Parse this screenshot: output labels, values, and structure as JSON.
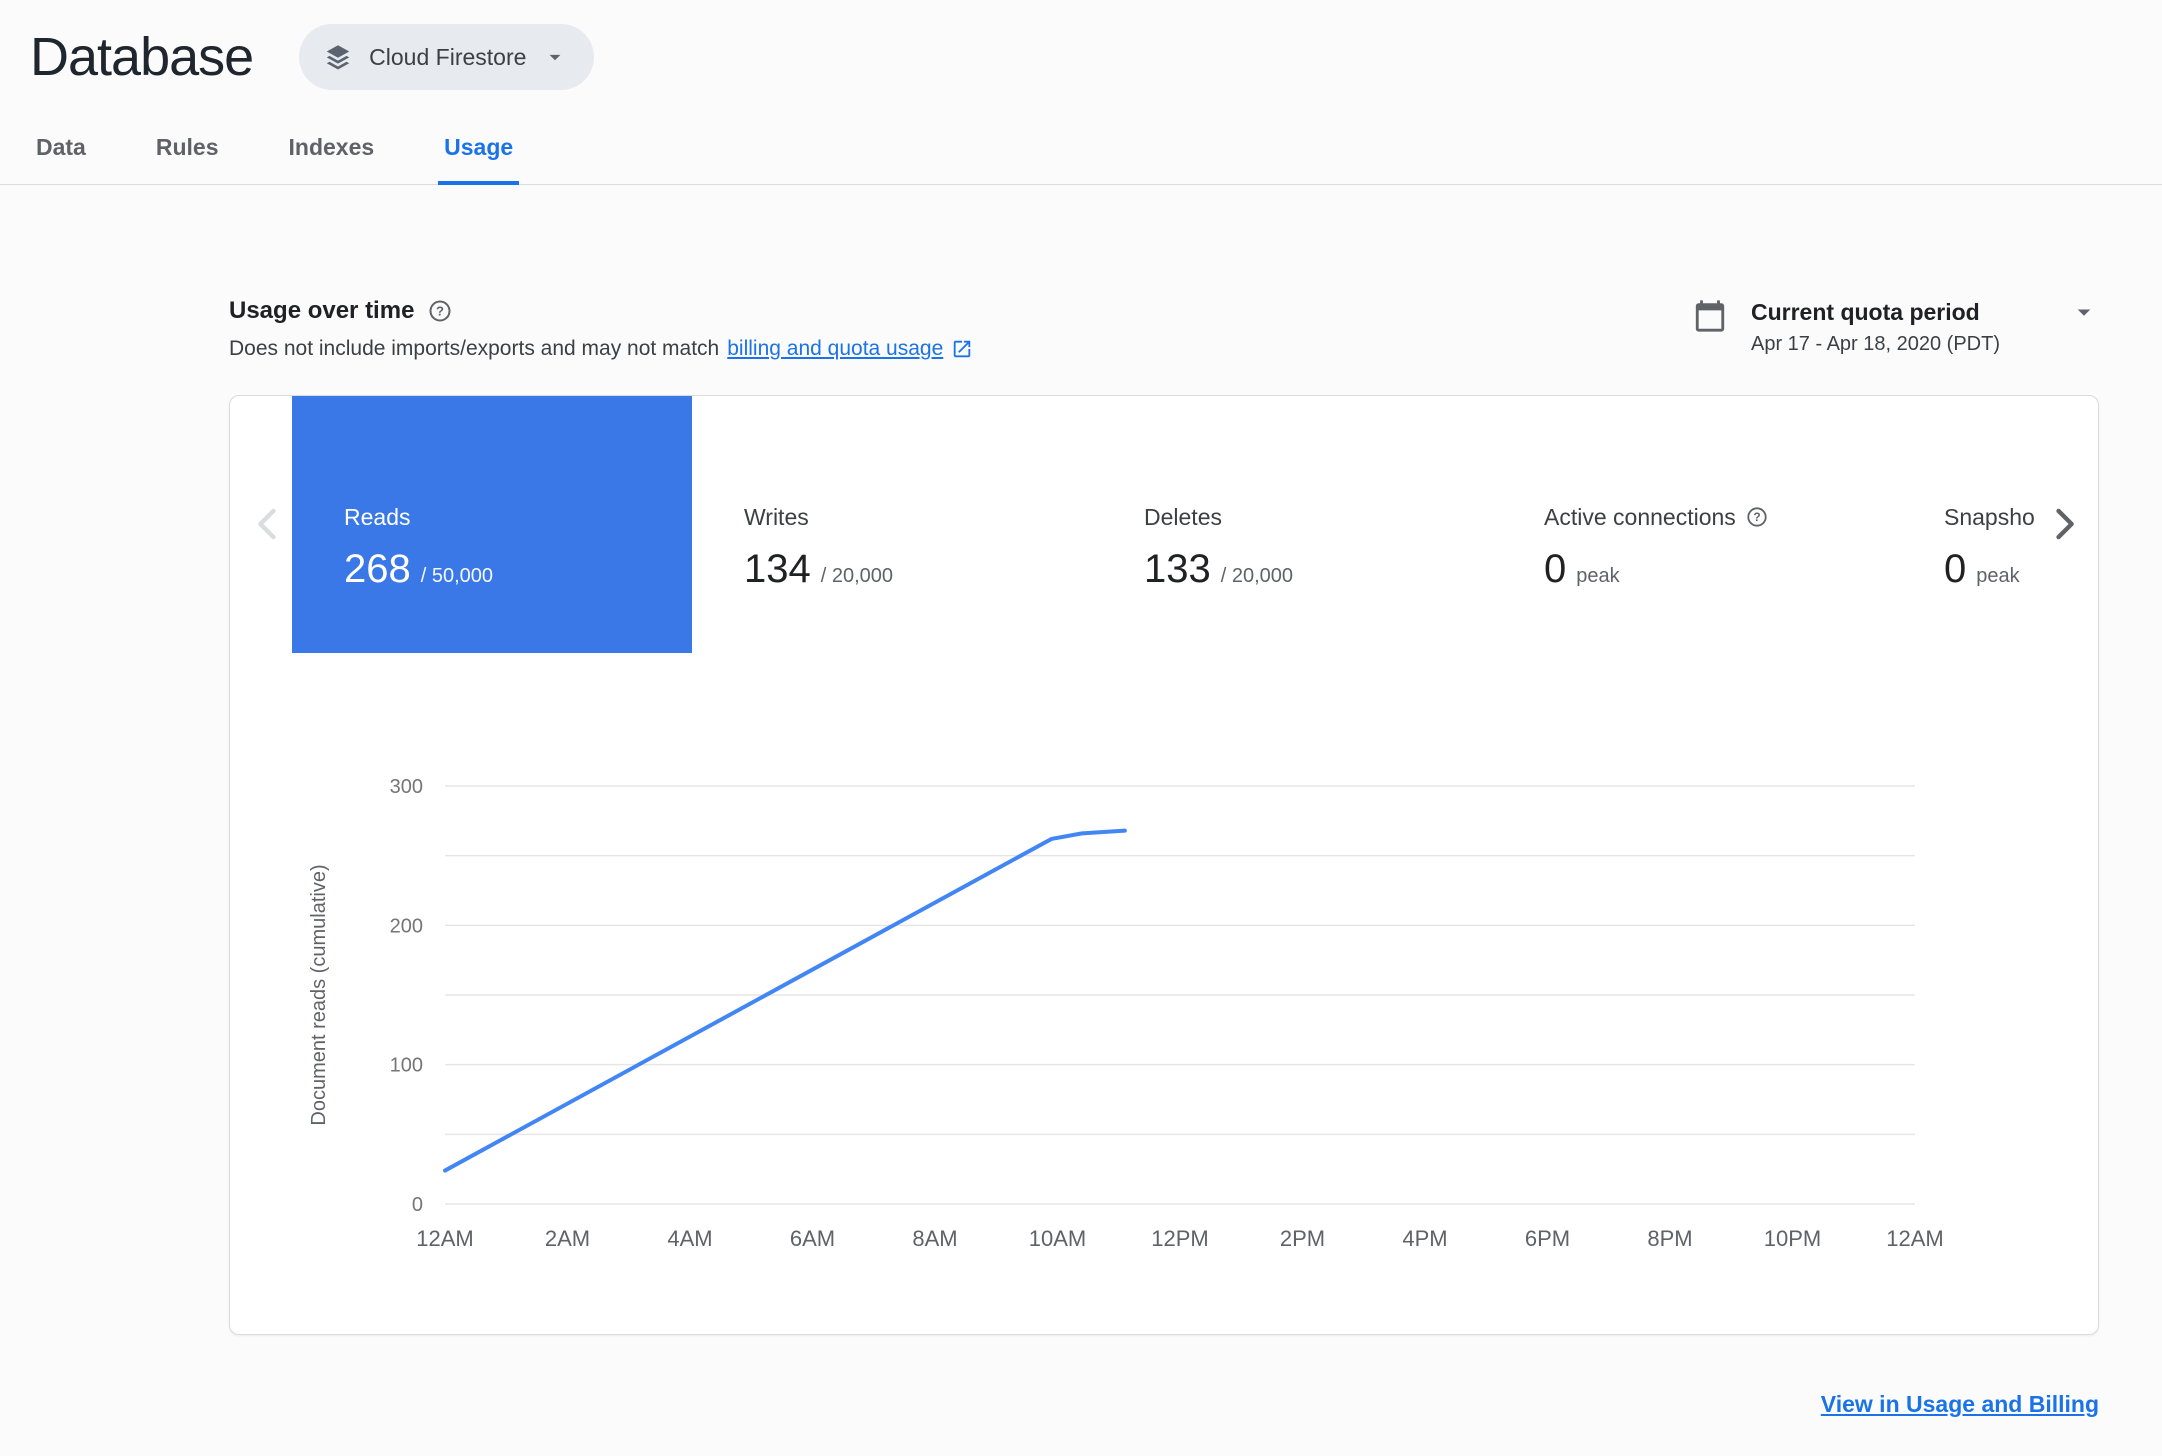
{
  "colors": {
    "accent": "#1a73e8",
    "selected_tile_bg": "#3b78e7"
  },
  "header": {
    "title": "Database",
    "product_selector_label": "Cloud Firestore"
  },
  "tabs": [
    {
      "label": "Data"
    },
    {
      "label": "Rules"
    },
    {
      "label": "Indexes"
    },
    {
      "label": "Usage"
    }
  ],
  "usage": {
    "heading": "Usage over time",
    "subtitle_text": "Does not include imports/exports and may not match",
    "subtitle_link": "billing and quota usage",
    "period_label": "Current quota period",
    "period_range": "Apr 17 - Apr 18, 2020 (PDT)"
  },
  "metrics": [
    {
      "name": "Reads",
      "value": "268",
      "quota": "/ 50,000"
    },
    {
      "name": "Writes",
      "value": "134",
      "quota": "/ 20,000"
    },
    {
      "name": "Deletes",
      "value": "133",
      "quota": "/ 20,000"
    },
    {
      "name": "Active connections",
      "value": "0",
      "quota": "peak"
    },
    {
      "name": "Snapsho",
      "value": "0",
      "quota": "peak"
    }
  ],
  "chart_data": {
    "type": "line",
    "title": "",
    "xlabel": "",
    "ylabel": "Document reads (cumulative)",
    "ylim": [
      0,
      300
    ],
    "yticks": [
      0,
      100,
      200,
      300
    ],
    "grid_interval": 50,
    "x_range_hours": [
      0,
      24
    ],
    "x_tick_labels": [
      "12AM",
      "2AM",
      "4AM",
      "6AM",
      "8AM",
      "10AM",
      "12PM",
      "2PM",
      "4PM",
      "6PM",
      "8PM",
      "10PM",
      "12AM"
    ],
    "legend": "off",
    "series": [
      {
        "name": "Document reads (cumulative)",
        "color": "#4285f4",
        "points": [
          {
            "hour": 0,
            "value": 24
          },
          {
            "hour": 9.9,
            "value": 262
          },
          {
            "hour": 10.4,
            "value": 266
          },
          {
            "hour": 11.1,
            "value": 268
          }
        ]
      }
    ]
  },
  "footer_link": "View in Usage and Billing"
}
